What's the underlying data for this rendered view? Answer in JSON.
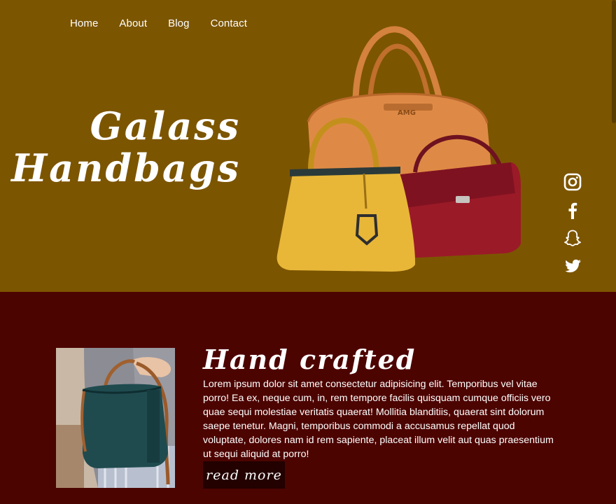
{
  "nav": {
    "items": [
      {
        "label": "Home"
      },
      {
        "label": "About"
      },
      {
        "label": "Blog"
      },
      {
        "label": "Contact"
      }
    ]
  },
  "hero": {
    "title_line1": "Galass",
    "title_line2": "Handbags",
    "bag_brand_text": "AMG"
  },
  "social": {
    "icons": [
      "instagram-icon",
      "facebook-icon",
      "snapchat-icon",
      "twitter-icon"
    ]
  },
  "feature": {
    "title": "Hand crafted",
    "text": "Lorem ipsum dolor sit amet consectetur adipisicing elit. Temporibus vel vitae porro! Ea ex, neque cum, in, rem tempore facilis quisquam cumque officiis vero quae sequi molestiae veritatis quaerat! Mollitia blanditiis, quaerat sint dolorum saepe tenetur. Magni, temporibus commodi a accusamus repellat quod voluptate, dolores nam id rem sapiente, placeat illum velit aut quas praesentium ut sequi aliquid at porro!",
    "button_label": "read more"
  },
  "colors": {
    "hero_bg": "#7c5501",
    "section_bg": "#4c0401",
    "button_bg": "#220100",
    "text": "#ffffff"
  }
}
